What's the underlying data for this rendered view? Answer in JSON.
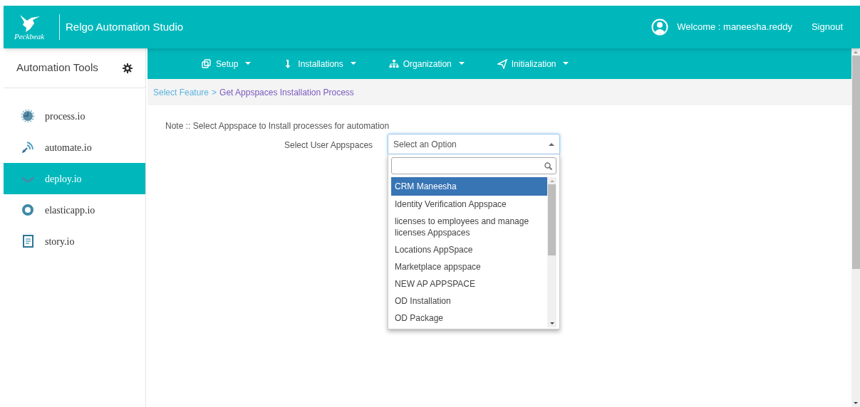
{
  "header": {
    "logo_text": "Peckbeak",
    "title": "Relgo Automation Studio",
    "welcome": "Welcome : maneesha.reddy",
    "signout": "Signout"
  },
  "sidebar": {
    "title": "Automation Tools",
    "items": [
      {
        "label": "process.io",
        "selected": false
      },
      {
        "label": "automate.io",
        "selected": false
      },
      {
        "label": "deploy.io",
        "selected": true
      },
      {
        "label": "elasticapp.io",
        "selected": false
      },
      {
        "label": "story.io",
        "selected": false
      }
    ]
  },
  "menu": [
    {
      "label": "Setup"
    },
    {
      "label": "Installations"
    },
    {
      "label": "Organization"
    },
    {
      "label": "Initialization"
    }
  ],
  "breadcrumb": {
    "link": "Select Feature",
    "separator": ">",
    "current": "Get Appspaces Installation Process"
  },
  "note": "Note :: Select Appspace to Install processes for automation",
  "field_label": "Select User Appspaces",
  "select": {
    "placeholder": "Select an Option",
    "expanded": true,
    "options": [
      {
        "label": "CRM Maneesha",
        "selected": true
      },
      {
        "label": "Identity Verification Appspace",
        "selected": false
      },
      {
        "label": "licenses to employees and manage licenses Appspaces",
        "selected": false
      },
      {
        "label": "Locations AppSpace",
        "selected": false
      },
      {
        "label": "Marketplace appspace",
        "selected": false
      },
      {
        "label": "NEW AP APPSPACE",
        "selected": false
      },
      {
        "label": "OD Installation",
        "selected": false
      },
      {
        "label": "OD Package",
        "selected": false
      }
    ]
  }
}
